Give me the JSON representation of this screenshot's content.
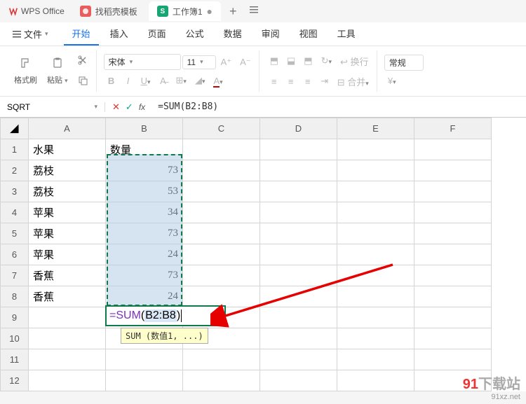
{
  "app": {
    "name": "WPS Office"
  },
  "tabs": [
    {
      "icon_bg": "#e85d5d",
      "icon_text": "",
      "label": "找稻壳模板"
    },
    {
      "icon_bg": "#17a673",
      "icon_text": "S",
      "label": "工作簿1",
      "dirty": "●"
    }
  ],
  "file_menu": "文件",
  "menus": [
    "开始",
    "插入",
    "页面",
    "公式",
    "数据",
    "审阅",
    "视图",
    "工具"
  ],
  "ribbon": {
    "format_painter": "格式刷",
    "paste": "粘贴",
    "font_name": "宋体",
    "font_size": "11",
    "wrap": "换行",
    "merge": "合并",
    "general": "常规",
    "currency": "¥"
  },
  "formula_bar": {
    "namebox": "SQRT",
    "formula": "=SUM(B2:B8)"
  },
  "columns": [
    "A",
    "B",
    "C",
    "D",
    "E",
    "F"
  ],
  "rows": [
    "1",
    "2",
    "3",
    "4",
    "5",
    "6",
    "7",
    "8",
    "9",
    "10",
    "11",
    "12"
  ],
  "cells": {
    "A1": "水果",
    "B1": "数量",
    "A2": "荔枝",
    "B2": "73",
    "A3": "荔枝",
    "B3": "53",
    "A4": "苹果",
    "B4": "34",
    "A5": "苹果",
    "B5": "73",
    "A6": "苹果",
    "B6": "24",
    "A7": "香蕉",
    "B7": "73",
    "A8": "香蕉",
    "B8": "24"
  },
  "active_formula": {
    "fn": "=SUM",
    "open": "(",
    "ref": "B2:B8",
    "close": ")"
  },
  "tooltip": "SUM (数值1, ...)",
  "watermark": {
    "brand": "91",
    "text": "下载站",
    "url": "91xz.net"
  }
}
